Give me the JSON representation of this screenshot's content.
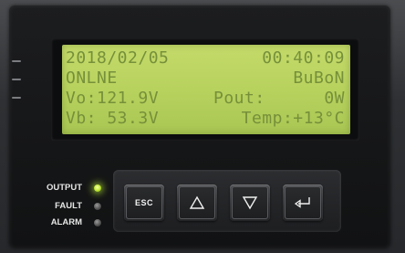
{
  "display": {
    "date": "2018/02/05",
    "time": "00:40:09",
    "status": "ONLNE",
    "mode": "BuBoN",
    "vo_label": "Vo:121.9V",
    "pout_label": "Pout:",
    "pout_value": "0W",
    "vb_label": "Vb: 53.3V",
    "temp_label": "Temp:+13°C"
  },
  "indicators": {
    "output": {
      "label": "OUTPUT",
      "state": "on"
    },
    "fault": {
      "label": "FAULT",
      "state": "off"
    },
    "alarm": {
      "label": "ALARM",
      "state": "off"
    }
  },
  "buttons": {
    "esc": "ESC",
    "up_icon": "triangle-up-icon",
    "down_icon": "triangle-down-icon",
    "enter_icon": "enter-arrow-icon"
  },
  "colors": {
    "lcd_background": "#b8d25e",
    "lcd_text": "#76903a",
    "led_on": "#c9ee3e",
    "panel": "#151617"
  }
}
